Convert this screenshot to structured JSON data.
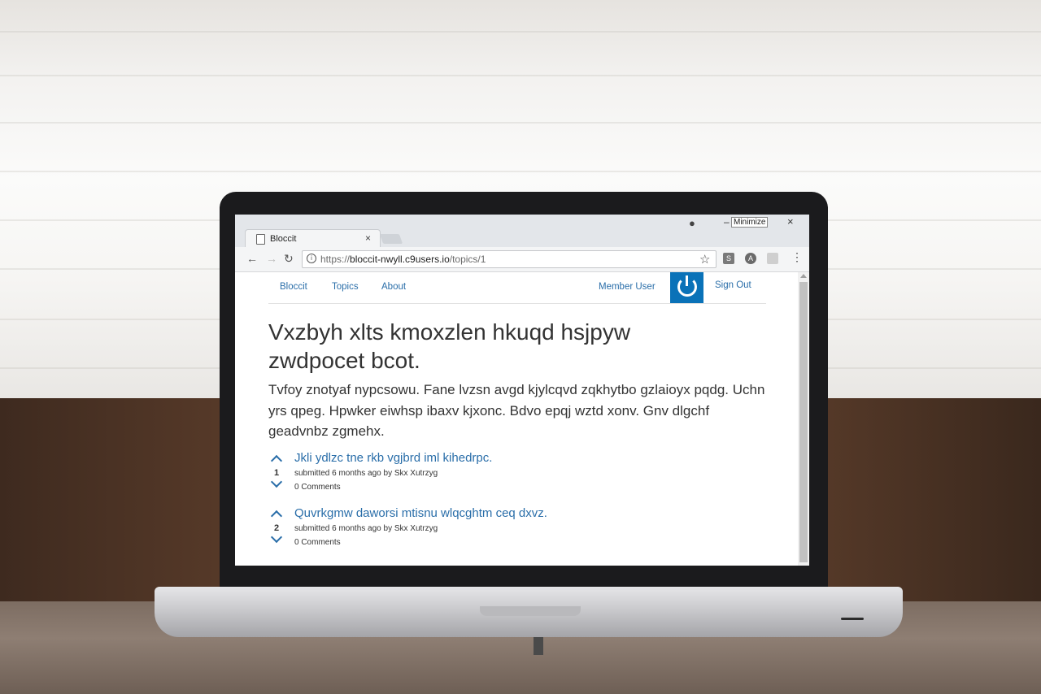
{
  "browser": {
    "tab_title": "Bloccit",
    "tab_close": "×",
    "minimize_tooltip": "Minimize",
    "minimize_glyph": "–",
    "close_glyph": "×",
    "url_scheme": "https://",
    "url_host": "bloccit-nwyll.c9users.io",
    "url_path": "/topics/1",
    "back_glyph": "←",
    "forward_glyph": "→",
    "reload_glyph": "↻",
    "star_glyph": "☆",
    "menu_glyph": "⋮",
    "extensions": [
      "s-extension-icon",
      "angular-extension-icon",
      "generic-extension-icon"
    ]
  },
  "site_nav": {
    "brand": "Bloccit",
    "topics": "Topics",
    "about": "About",
    "user": "Member User",
    "sign_out": "Sign Out"
  },
  "topic": {
    "title": "Vxzbyh xlts kmoxzlen hkuqd hsjpyw zwdpocet bcot.",
    "description": "Tvfoy znotyaf nypcsowu. Fane lvzsn avgd kjylcqvd zqkhytbo gzlaioyx pqdg. Uchn yrs qpeg. Hpwker eiwhsp ibaxv kjxonc. Bdvo epqj wztd xonv. Gnv dlgchf geadvnbz zgmehx."
  },
  "posts": [
    {
      "votes": "1",
      "title": "Jkli ydlzc tne rkb vgjbrd iml kihedrpc.",
      "meta": "submitted 6 months ago by Skx Xutrzyg",
      "comments": "0 Comments"
    },
    {
      "votes": "2",
      "title": "Quvrkgmw daworsi mtisnu wlqcghtm ceq dxvz.",
      "meta": "submitted 6 months ago by Skx Xutrzyg",
      "comments": "0 Comments"
    }
  ],
  "colors": {
    "link": "#2a6ea9",
    "avatar_bg": "#0a72b8"
  }
}
